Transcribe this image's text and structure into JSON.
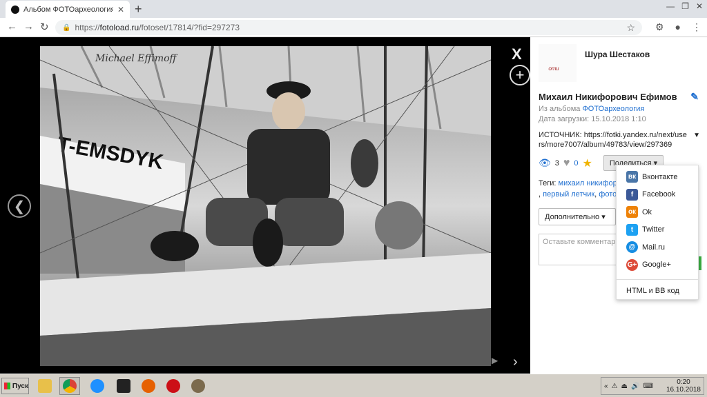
{
  "browser": {
    "tab_title": "Альбом ФОТОархеология на фото",
    "tab_close": "✕",
    "new_tab": "+",
    "url_prefix": "https://",
    "url_host": "fotoload.ru",
    "url_path": "/fotoset/17814/?fid=297273"
  },
  "viewer": {
    "close_label": "X",
    "zoom_label": "+",
    "prev_label": "❮",
    "next_label": "›",
    "play_label": "▶",
    "photo_signature": "Michael Effimoff",
    "photo_sign_text": "T-EMSDYK"
  },
  "panel": {
    "author_name": "Шура Шестаков",
    "avatar_text": "ᵒᵐᵘ",
    "photo_title": "Михаил Никифорович Ефимов",
    "album_prefix": "Из альбома ",
    "album_link": "ФОТОархеология",
    "upload_date": "Дата загрузки: 15.10.2018 1:10",
    "source_text": "ИСТОЧНИК: https://fotki.yandex.ru/next/users/more7007/album/49783/view/297369",
    "views": "3",
    "likes": "0",
    "share_label": "Поделиться",
    "tags_prefix": "Теги: ",
    "tag1": "михаил никифор",
    "tags_sep": ", ",
    "tag2": "первый летчик",
    "tags_sep2": ", ",
    "tag3": "фото",
    "more_label": "Дополнительно",
    "comment_placeholder": "Оставьте комментар"
  },
  "share_menu": {
    "items": [
      {
        "label": "Вконтакте",
        "icon": "vk-icon",
        "color": "#4a76a8",
        "glyph": "вк"
      },
      {
        "label": "Facebook",
        "icon": "facebook-icon",
        "color": "#3b5998",
        "glyph": "f"
      },
      {
        "label": "Ok",
        "icon": "ok-icon",
        "color": "#ee8208",
        "glyph": "ок"
      },
      {
        "label": "Twitter",
        "icon": "twitter-icon",
        "color": "#1da1f2",
        "glyph": "t"
      },
      {
        "label": "Mail.ru",
        "icon": "mailru-icon",
        "color": "#168de2",
        "glyph": "@"
      },
      {
        "label": "Google+",
        "icon": "googleplus-icon",
        "color": "#dd4b39",
        "glyph": "G+"
      }
    ],
    "html_label": "HTML и BB код"
  },
  "taskbar": {
    "start_label": "Пуск",
    "time": "0:20",
    "date": "16.10.2018"
  }
}
